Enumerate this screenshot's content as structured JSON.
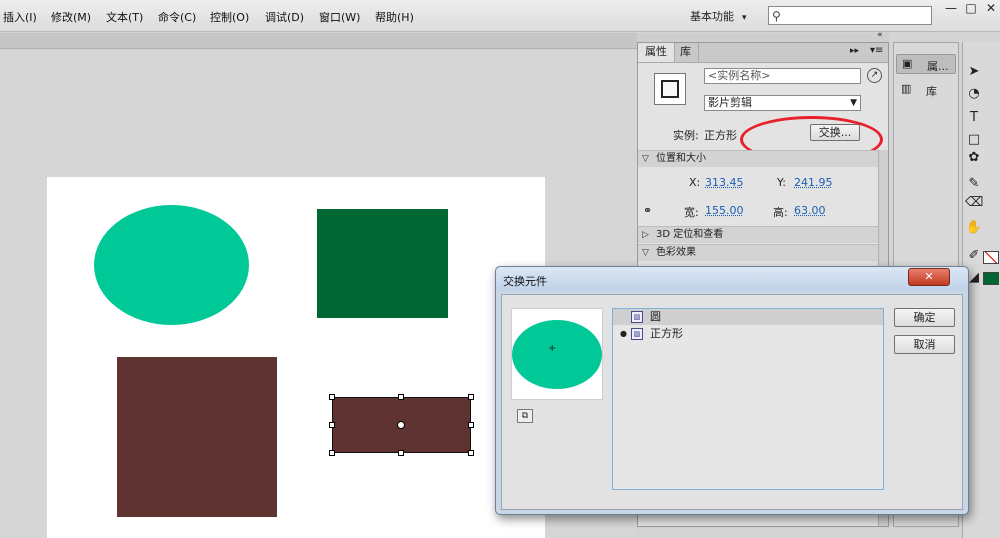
{
  "menu": {
    "items": [
      "插入(I)",
      "修改(M)",
      "文本(T)",
      "命令(C)",
      "控制(O)",
      "调试(D)",
      "窗口(W)",
      "帮助(H)"
    ],
    "workspace_label": "基本功能",
    "search_placeholder": ""
  },
  "window_controls": {
    "minimize": "—",
    "restore": "□",
    "close": "✕"
  },
  "stage": {
    "shapes": [
      {
        "kind": "ellipse",
        "color": "#00c896"
      },
      {
        "kind": "rect",
        "color": "#006633"
      },
      {
        "kind": "rect",
        "color": "#5e3331"
      },
      {
        "kind": "rect-selected",
        "color": "#5e3331"
      }
    ]
  },
  "properties": {
    "tabs": [
      "属性",
      "库"
    ],
    "instance_name_placeholder": "<实例名称>",
    "symbol_type": "影片剪辑",
    "instance_label": "实例:",
    "instance_value": "正方形",
    "swap_button": "交换...",
    "position_size_section": "位置和大小",
    "x_label": "X:",
    "x_value": "313.45",
    "y_label": "Y:",
    "y_value": "241.95",
    "width_label": "宽:",
    "width_value": "155.00",
    "height_label": "高:",
    "height_value": "63.00",
    "section_3d": "3D 定位和查看",
    "section_color": "色彩效果"
  },
  "mini_panel": {
    "items": [
      "属...",
      "库"
    ]
  },
  "swap_dialog": {
    "title": "交换元件",
    "close": "✕",
    "symbols": [
      {
        "name": "圆",
        "current": false
      },
      {
        "name": "正方形",
        "current": true
      }
    ],
    "ok": "确定",
    "cancel": "取消",
    "preview_color": "#00c896"
  },
  "highlight_color": "#e8202a"
}
